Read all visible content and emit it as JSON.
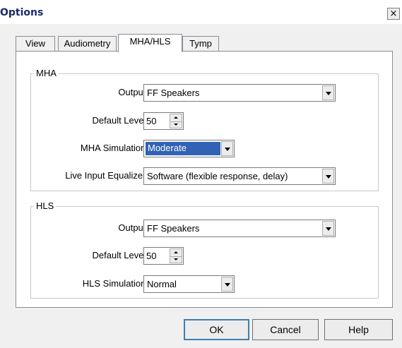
{
  "window": {
    "title": "Options",
    "close_label": "×"
  },
  "tabs": [
    {
      "label": "View",
      "active": false
    },
    {
      "label": "Audiometry",
      "active": false
    },
    {
      "label": "MHA/HLS",
      "active": true
    },
    {
      "label": "Tymp",
      "active": false
    }
  ],
  "mha": {
    "group_label": "MHA",
    "output_label": "Output:",
    "output_value": "FF Speakers",
    "default_level_label": "Default Level:",
    "default_level_value": "50",
    "simulation_label": "MHA Simulation:",
    "simulation_value": "Moderate",
    "equalizer_label": "Live Input Equalizer:",
    "equalizer_value": "Software (flexible response, delay)"
  },
  "hls": {
    "group_label": "HLS",
    "output_label": "Output:",
    "output_value": "FF Speakers",
    "default_level_label": "Default Level:",
    "default_level_value": "50",
    "simulation_label": "HLS Simulation:",
    "simulation_value": "Normal"
  },
  "buttons": {
    "ok": "OK",
    "cancel": "Cancel",
    "help": "Help"
  },
  "colors": {
    "title_text": "#1a2a6a",
    "selection_highlight": "#3162b5",
    "dialog_background": "#f0f0f0"
  }
}
